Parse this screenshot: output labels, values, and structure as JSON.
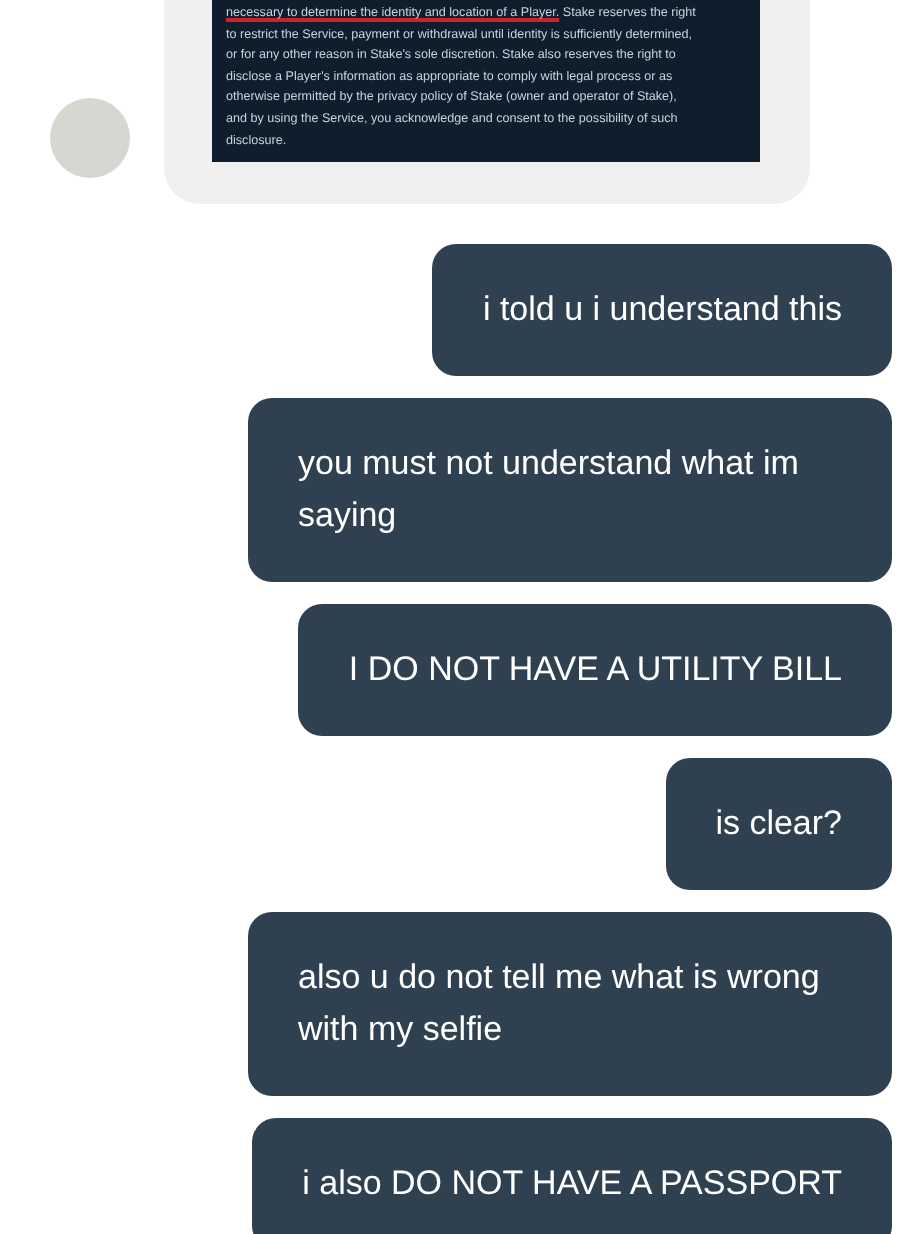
{
  "messages": [
    {
      "kind": "incoming",
      "attachment": {
        "lines": [
          [
            {
              "text": "necessary to determine the identity and location of a Player.",
              "underlined": true
            },
            {
              "text": " Stake reserves the right",
              "underlined": false
            }
          ],
          [
            {
              "text": "to restrict the Service, payment or withdrawal until identity is sufficiently determined,",
              "underlined": false
            }
          ],
          [
            {
              "text": "or for any other reason in Stake's sole discretion. Stake also reserves the right to",
              "underlined": false
            }
          ],
          [
            {
              "text": "disclose a Player's information as appropriate to comply with legal process or as",
              "underlined": false
            }
          ],
          [
            {
              "text": "otherwise permitted by the privacy policy of Stake (owner and operator of Stake),",
              "underlined": false
            }
          ],
          [
            {
              "text": "and by using the Service, you acknowledge and consent to the possibility of such",
              "underlined": false
            }
          ],
          [
            {
              "text": "disclosure.",
              "underlined": false
            }
          ]
        ]
      }
    },
    {
      "kind": "outgoing",
      "text": "i told u i understand this"
    },
    {
      "kind": "outgoing",
      "text": "you must not understand what im saying"
    },
    {
      "kind": "outgoing",
      "text": "I DO NOT HAVE A UTILITY BILL"
    },
    {
      "kind": "outgoing",
      "text": "is clear?"
    },
    {
      "kind": "outgoing",
      "text": "also u do not tell me what is wrong with my selfie"
    },
    {
      "kind": "outgoing",
      "text": "i also DO NOT HAVE A PASSPORT"
    }
  ]
}
